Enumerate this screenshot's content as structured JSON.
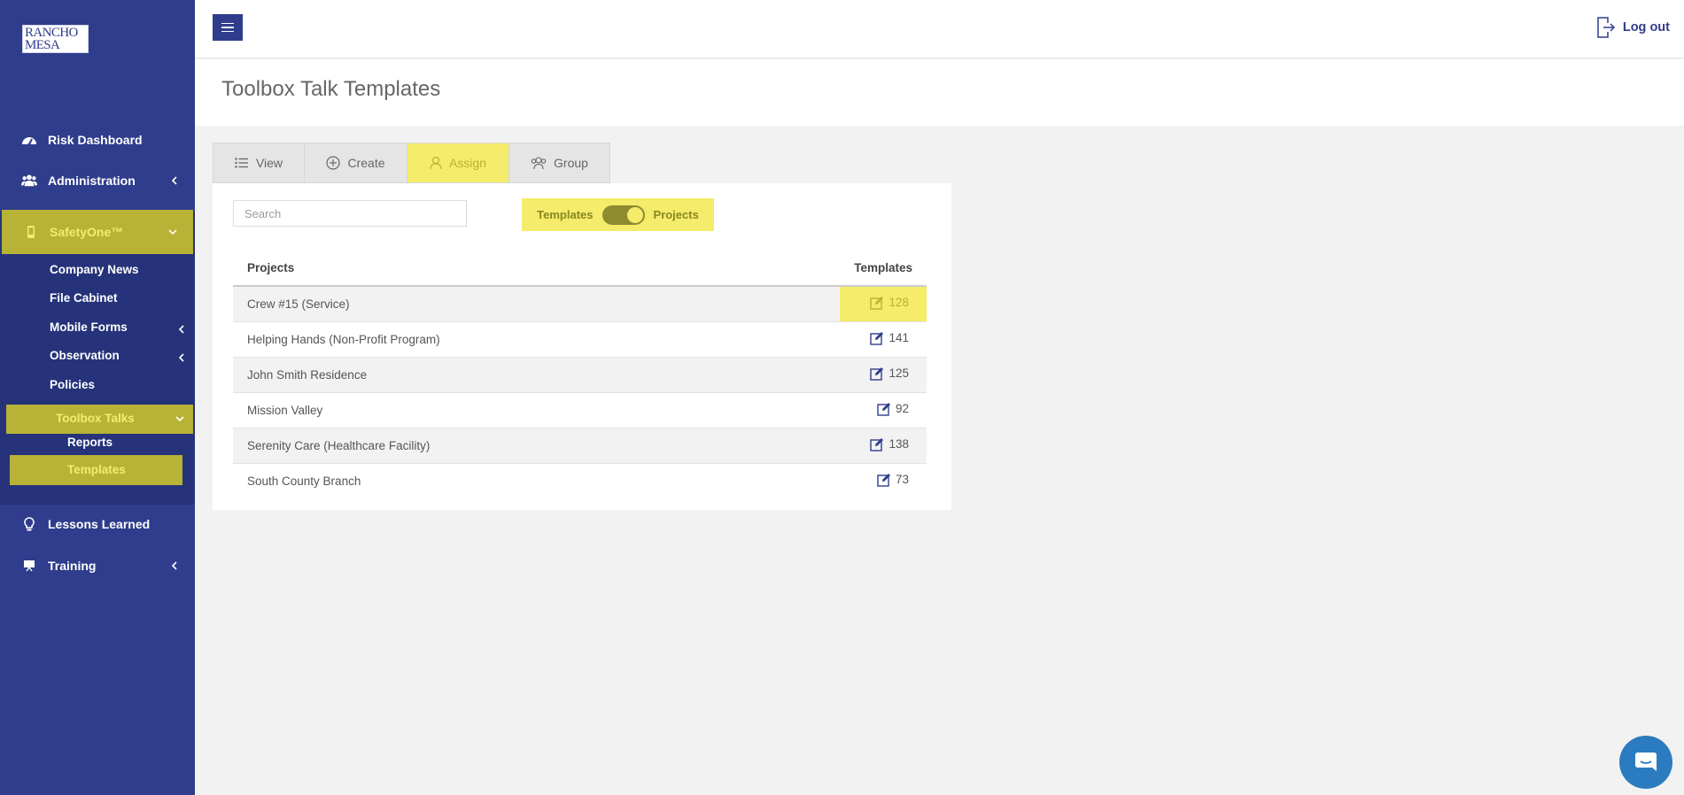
{
  "brand": {
    "logo_line1": "RANCHO",
    "logo_line2": "MESA"
  },
  "topbar": {
    "logout_label": "Log out"
  },
  "sidebar": {
    "items": [
      {
        "label": "Risk Dashboard",
        "icon": "dashboard-icon"
      },
      {
        "label": "Administration",
        "icon": "users-icon"
      },
      {
        "label": "SafetyOne™",
        "icon": "mobile-icon"
      },
      {
        "label": "Lessons Learned",
        "icon": "lightbulb-icon"
      },
      {
        "label": "Training",
        "icon": "presentation-icon"
      }
    ],
    "safetyone_children": [
      {
        "label": "Company News"
      },
      {
        "label": "File Cabinet"
      },
      {
        "label": "Mobile Forms"
      },
      {
        "label": "Observation"
      },
      {
        "label": "Policies"
      },
      {
        "label": "Toolbox Talks"
      }
    ],
    "toolbox_children": [
      {
        "label": "Reports"
      },
      {
        "label": "Templates"
      }
    ]
  },
  "page": {
    "title": "Toolbox Talk Templates"
  },
  "tabs": [
    {
      "label": "View",
      "icon": "list-icon"
    },
    {
      "label": "Create",
      "icon": "plus-circle-icon"
    },
    {
      "label": "Assign",
      "icon": "user-icon"
    },
    {
      "label": "Group",
      "icon": "group-icon"
    }
  ],
  "active_tab": "Assign",
  "search": {
    "placeholder": "Search"
  },
  "toggle": {
    "left_label": "Templates",
    "right_label": "Projects",
    "selected": "Projects"
  },
  "table": {
    "headers": [
      "Projects",
      "Templates"
    ],
    "rows": [
      {
        "project": "Crew #15 (Service)",
        "templates": "128"
      },
      {
        "project": "Helping Hands (Non-Profit Program)",
        "templates": "141"
      },
      {
        "project": "John Smith Residence",
        "templates": "125"
      },
      {
        "project": "Mission Valley",
        "templates": "92"
      },
      {
        "project": "Serenity Care (Healthcare Facility)",
        "templates": "138"
      },
      {
        "project": "South County Branch",
        "templates": "73"
      }
    ]
  },
  "colors": {
    "sidebar_bg": "#2f3d8c",
    "accent_yellow": "#f4ec6a",
    "accent_olive": "#b8b236",
    "chat_blue": "#2b7bc0"
  }
}
